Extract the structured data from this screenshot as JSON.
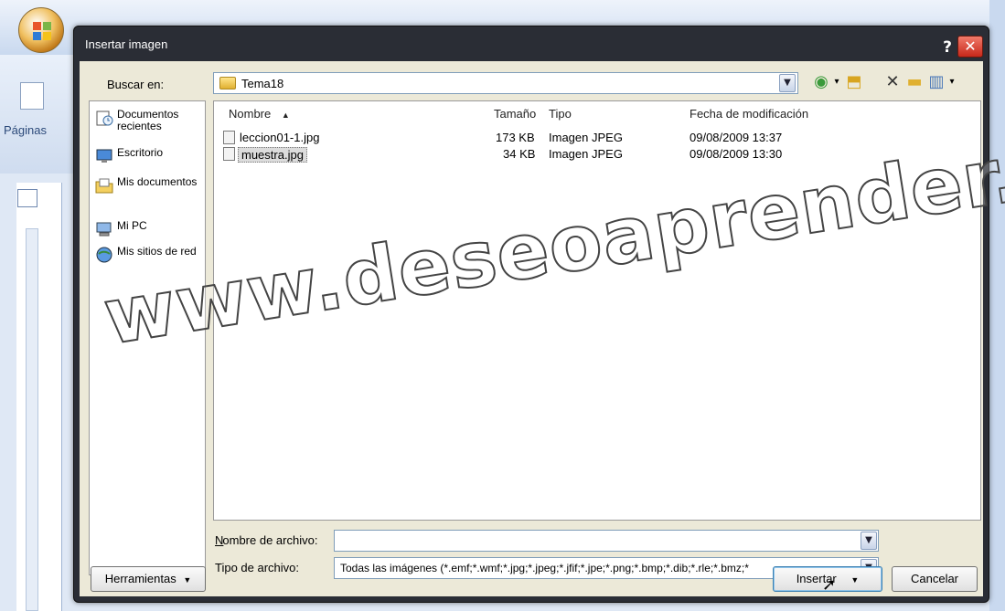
{
  "window": {
    "ribbon_label": "Páginas"
  },
  "dialog": {
    "title": "Insertar imagen",
    "help": "?",
    "close": "✕"
  },
  "toolbar": {
    "look_in_label": "Buscar en:",
    "look_in_value": "Tema18"
  },
  "places": [
    {
      "label": "Documentos recientes",
      "icon": "recent-documents-icon"
    },
    {
      "label": "Escritorio",
      "icon": "desktop-icon"
    },
    {
      "label": "Mis documentos",
      "icon": "my-documents-icon"
    },
    {
      "label": "Mi PC",
      "icon": "my-computer-icon"
    },
    {
      "label": "Mis sitios de red",
      "icon": "network-places-icon"
    }
  ],
  "file_list": {
    "columns": [
      "Nombre",
      "Tamaño",
      "Tipo",
      "Fecha de modificación"
    ],
    "sort_indicator": "▲",
    "rows": [
      {
        "name": "leccion01-1.jpg",
        "size": "173 KB",
        "type": "Imagen JPEG",
        "date": "09/08/2009 13:37"
      },
      {
        "name": "muestra.jpg",
        "size": "34 KB",
        "type": "Imagen JPEG",
        "date": "09/08/2009 13:30"
      }
    ]
  },
  "watermark": "www.deseoaprender.com",
  "filename": {
    "label": "Nombre de archivo:",
    "value": ""
  },
  "filetype": {
    "label": "Tipo de archivo:",
    "value": "Todas las imágenes (*.emf;*.wmf;*.jpg;*.jpeg;*.jfif;*.jpe;*.png;*.bmp;*.dib;*.rle;*.bmz;*"
  },
  "buttons": {
    "tools": "Herramientas",
    "insert": "Insertar",
    "cancel": "Cancelar"
  }
}
